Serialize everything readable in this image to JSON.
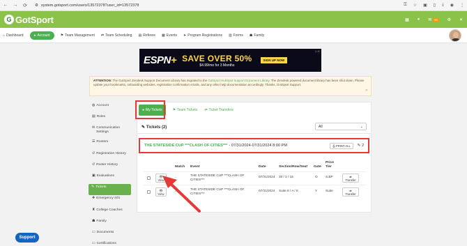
{
  "browser": {
    "url": "system.gotsport.com/users/13572378?user_id=13572378"
  },
  "topbar": {
    "logo_text": "GotSport",
    "logo_mark": "G",
    "badge": "99"
  },
  "nav": {
    "items": [
      {
        "label": "Dashboard",
        "icon": "dashboard-icon"
      },
      {
        "label": "Account",
        "icon": "account-icon"
      },
      {
        "label": "Team Management",
        "icon": "team-icon"
      },
      {
        "label": "Team Scheduling",
        "icon": "scheduling-icon"
      },
      {
        "label": "Referee",
        "icon": "referee-icon"
      },
      {
        "label": "Events",
        "icon": "events-icon"
      },
      {
        "label": "Program Registrations",
        "icon": "program-icon"
      },
      {
        "label": "Forms",
        "icon": "forms-icon"
      },
      {
        "label": "Family",
        "icon": "family-icon"
      }
    ],
    "active": "Account"
  },
  "ad": {
    "brand": "ESPN",
    "brand_plus": "+",
    "offer": "SAVE OVER 50%",
    "price": "$4.99/mo for 3 Months",
    "signup": "SIGN UP NOW"
  },
  "attention": {
    "label": "ATTENTION:",
    "text_1": " The GotSport Zendesk Support Document Library has migrated to the ",
    "link": "GotSport HubSpot Support Document Library",
    "text_2": ". The Zendesk powered document library has been shut down. Please update your bookmarks, onboarding websites, registration confirmation emails, and any other help documentation accordingly. Thanks, GotSport Support."
  },
  "sidebar": {
    "items": [
      {
        "label": "Account"
      },
      {
        "label": "Roles"
      },
      {
        "label": "Communication Settings"
      },
      {
        "label": "Rosters"
      },
      {
        "label": "Registration History"
      },
      {
        "label": "Roster History"
      },
      {
        "label": "Evaluations"
      },
      {
        "label": "Tickets"
      },
      {
        "label": "Emergency Info"
      },
      {
        "label": "College Coaches"
      },
      {
        "label": "Family"
      },
      {
        "label": "Documents"
      },
      {
        "label": "Certifications"
      }
    ],
    "active": "Tickets"
  },
  "tabs": {
    "my_tickets": "My Tickets",
    "team_tickets": "Team Tickets",
    "ticket_transfers": "Ticket Transfers"
  },
  "tickets": {
    "heading": "Tickets (2)",
    "filter_value": "All",
    "event_name": "THE STATESIDE CUP ***CLASH OF CITIES***",
    "event_dates": " - 07/31/2024-07/31/2024 8:00 PM",
    "print_all": "PRINT ALL",
    "count": "2",
    "columns": [
      "Match",
      "Event",
      "Date",
      "Section/Row/Seat",
      "Gate",
      "Price Tier"
    ],
    "rows": [
      {
        "view": "View",
        "match": "-",
        "event": "THE STATESIDE CUP ***CLASH OF CITIES***",
        "date": "07/31/2024",
        "seat": "30 / 1 / 15",
        "gate": "O",
        "tier": "S.BP",
        "transfer": "Transfer"
      },
      {
        "view": "View",
        "match": "-",
        "event": "THE STATESIDE CUP ***CLASH OF CITIES***",
        "date": "07/31/2024",
        "seat": "Suite 8 / A / 8",
        "gate": "Y",
        "tier": "Suite",
        "transfer": "Transfer"
      }
    ]
  },
  "support": {
    "label": "Support"
  }
}
